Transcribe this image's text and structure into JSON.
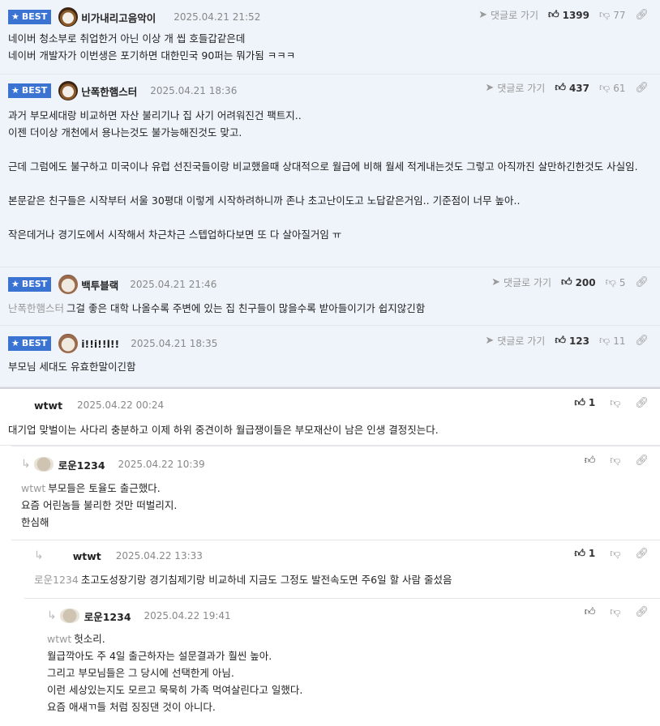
{
  "labels": {
    "best": "BEST",
    "reply_link": "댓글로 가기"
  },
  "best_comments": [
    {
      "nick": "비가내리고음악이",
      "date": "2025.04.21 21:52",
      "up": "1399",
      "down": "77",
      "body": "네이버 청소부로 취업한거 아닌 이상 개 씹 호들갑같은데\n네이버 개발자가 이번생은 포기하면 대한민국 90퍼는 뭐가됨 ㅋㅋㅋ"
    },
    {
      "nick": "난폭한햄스터",
      "date": "2025.04.21 18:36",
      "up": "437",
      "down": "61",
      "body": "과거 부모세대랑 비교하면 자산 불리기나 집 사기 어려워진건 팩트지..\n이젠 더이상 개천에서 용나는것도 불가능해진것도 맞고.\n\n근데 그럼에도 불구하고 미국이나 유럽 선진국들이랑 비교했을때 상대적으로 월급에 비해 월세 적게내는것도 그렇고 아직까진 살만하긴한것도 사실임.\n\n본문같은 친구들은 시작부터 서울 30평대 이렇게 시작하려하니까 존나 초고난이도고 노답같은거임.. 기준점이 너무 높아..\n\n작은데거나 경기도에서 시작해서 차근차근 스텝업하다보면 또 다 살아질거임 ㅠ"
    },
    {
      "nick": "백투블랙",
      "date": "2025.04.21 21:46",
      "up": "200",
      "down": "5",
      "mention": "난폭한햄스터",
      "body": "그걸 좋은 대학 나올수록 주변에 있는 집 친구들이 많을수록 받아들이기가 쉽지않긴함"
    },
    {
      "nick": "i!!i!!l!!",
      "date": "2025.04.21 18:35",
      "up": "123",
      "down": "11",
      "body": "부모님 세대도 유효한말이긴함"
    }
  ],
  "thread": [
    {
      "nick": "wtwt",
      "date": "2025.04.22 00:24",
      "up": "1",
      "body": "대기업 맞벌이는 사다리 충분하고 이제 하위 중견이하 월급쟁이들은 부모재산이 남은 인생 결정짓는다."
    },
    {
      "nick": "로운1234",
      "date": "2025.04.22 10:39",
      "up": "",
      "mention": "wtwt",
      "body": "부모들은 토율도 출근했다.\n요즘 어린놈들 불리한 것만 떠벌리지.\n한심해"
    },
    {
      "nick": "wtwt",
      "date": "2025.04.22 13:33",
      "up": "1",
      "mention": "로운1234",
      "body": "초고도성장기랑 경기침제기랑 비교하네 지금도 그정도 발전속도면 주6일 할 사람 줄섰음"
    },
    {
      "nick": "로운1234",
      "date": "2025.04.22 19:41",
      "up": "",
      "mention": "wtwt",
      "body": "헛소리.\n월급깍아도 주 4일 출근하자는 설문결과가 훨씬 높아.\n그리고 부모님들은 그 당시에 선택한게 아님.\n이런 세상있는지도 모르고 묵묵히 가족 먹여살린다고 일했다.\n요즘 애새ㄲ들 처럼 징징댄 것이 아니다."
    }
  ]
}
